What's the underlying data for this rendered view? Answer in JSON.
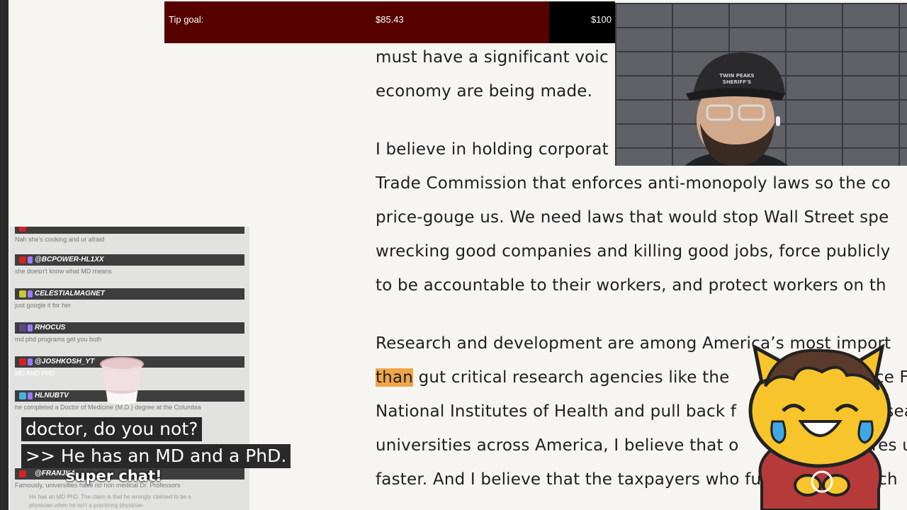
{
  "tip_goal": {
    "label": "Tip goal:",
    "current": "$85.43",
    "target": "$100",
    "progress_fraction": 0.854
  },
  "article": {
    "lines": [
      "must have a significant voic",
      "economy are being made.",
      "I believe in holding corporat",
      "Trade Commission that enforces anti-monopoly laws so the co",
      "price-gouge us. We need laws that would stop Wall Street spe",
      "wrecking good companies and killing good jobs, force publicly",
      "to be accountable to their workers, and protect workers on th",
      "Research and development are among America’s most import",
      "than",
      "gut critical research agencies like the",
      "nce Fo",
      "National Institutes of Health and pull back f",
      "esea",
      "universities across America, I believe that o",
      "res u",
      "faster. And I believe that the taxpayers who fu",
      "rch"
    ]
  },
  "chat": {
    "messages": [
      {
        "name": "",
        "text": "Nah she's cooking and ur afraid",
        "badge_color": "#d32222"
      },
      {
        "name": "@BCPOWER-HL1XX",
        "text": "she doesn't know what MD means",
        "badge_color": "#d32222"
      },
      {
        "name": "CELESTIALMAGNET",
        "text": "just google it for her",
        "badge_color": "#c8c832"
      },
      {
        "name": "RHOCUS",
        "text": "md phd programs get you both",
        "badge_color": "#5a4a8a"
      },
      {
        "name": "@JOSHKOSH_YT",
        "text": "MD AND PHD",
        "badge_color": "#d32222"
      },
      {
        "name": "HLNUBTV",
        "text": "he completed a Doctor of Medicine (M.D.) degree at the Columbia",
        "badge_color": "#4ab0e0"
      },
      {
        "name": "@FRANJKA",
        "text": "Famously, universities have no non medical Dr. Professors",
        "badge_color": "#d32222"
      }
    ],
    "footer_text": "He has an MD PhD. The claim is that he wrongly claimed to be a physician when he isn't a practicing physician."
  },
  "captions": {
    "line1": "doctor, do you not?",
    "line2": ">> He has an MD and a PhD."
  },
  "alert": {
    "text": "super chat!"
  },
  "webcam": {
    "hat_text": "TWIN PEAKS SHERIFF'S DEPARTMENT"
  },
  "colors": {
    "tip_fill": "#560000",
    "highlight": "#f0a64a",
    "chat_name_bg": "#3d3d3d"
  }
}
